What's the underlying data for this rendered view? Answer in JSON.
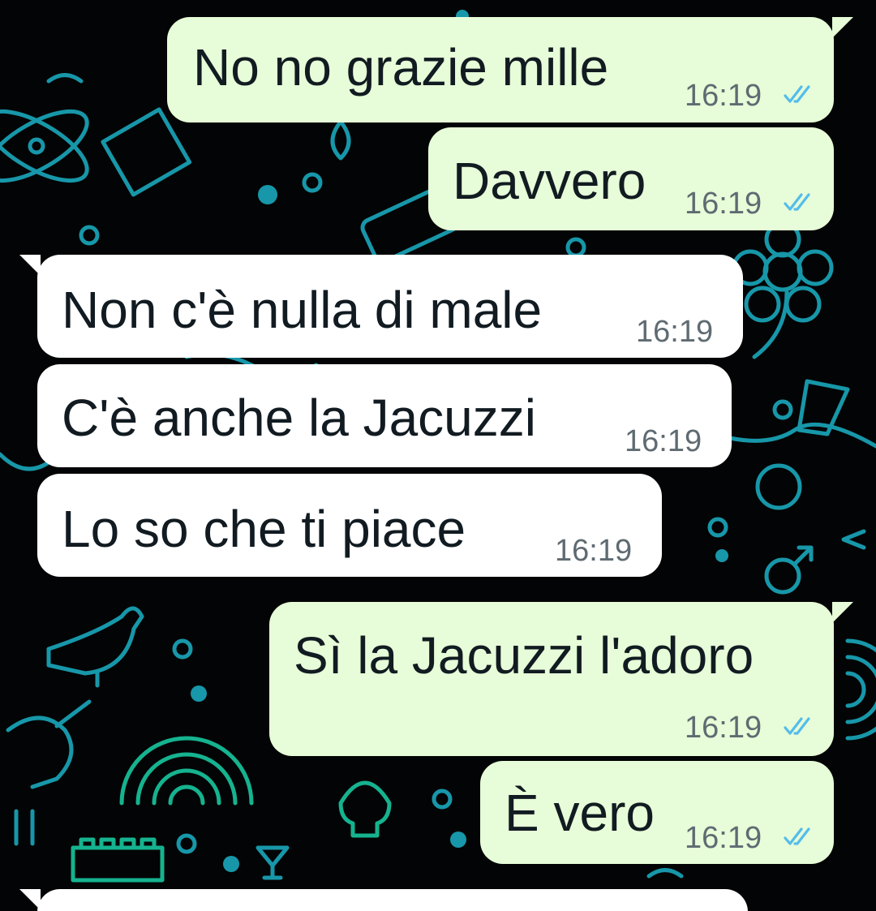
{
  "chat": {
    "messages": [
      {
        "direction": "outgoing",
        "text": "No no grazie mille",
        "time": "16:19",
        "status_icon": "double-check-read-icon"
      },
      {
        "direction": "outgoing",
        "text": "Davvero",
        "time": "16:19",
        "status_icon": "double-check-read-icon"
      },
      {
        "direction": "incoming",
        "text": "Non c'è nulla di male",
        "time": "16:19"
      },
      {
        "direction": "incoming",
        "text": "C'è anche la Jacuzzi",
        "time": "16:19"
      },
      {
        "direction": "incoming",
        "text": "Lo so che ti piace",
        "time": "16:19"
      },
      {
        "direction": "outgoing",
        "text": "Sì la Jacuzzi l'adoro",
        "time": "16:19",
        "status_icon": "double-check-read-icon"
      },
      {
        "direction": "outgoing",
        "text": "È vero",
        "time": "16:19",
        "status_icon": "double-check-read-icon"
      }
    ]
  },
  "colors": {
    "background": "#030405",
    "doodle": "#1fb6c9",
    "doodle_green": "#18c8a0",
    "outgoing_bubble": "#e7fcd8",
    "incoming_bubble": "#ffffff",
    "read_ticks": "#53bdeb"
  }
}
